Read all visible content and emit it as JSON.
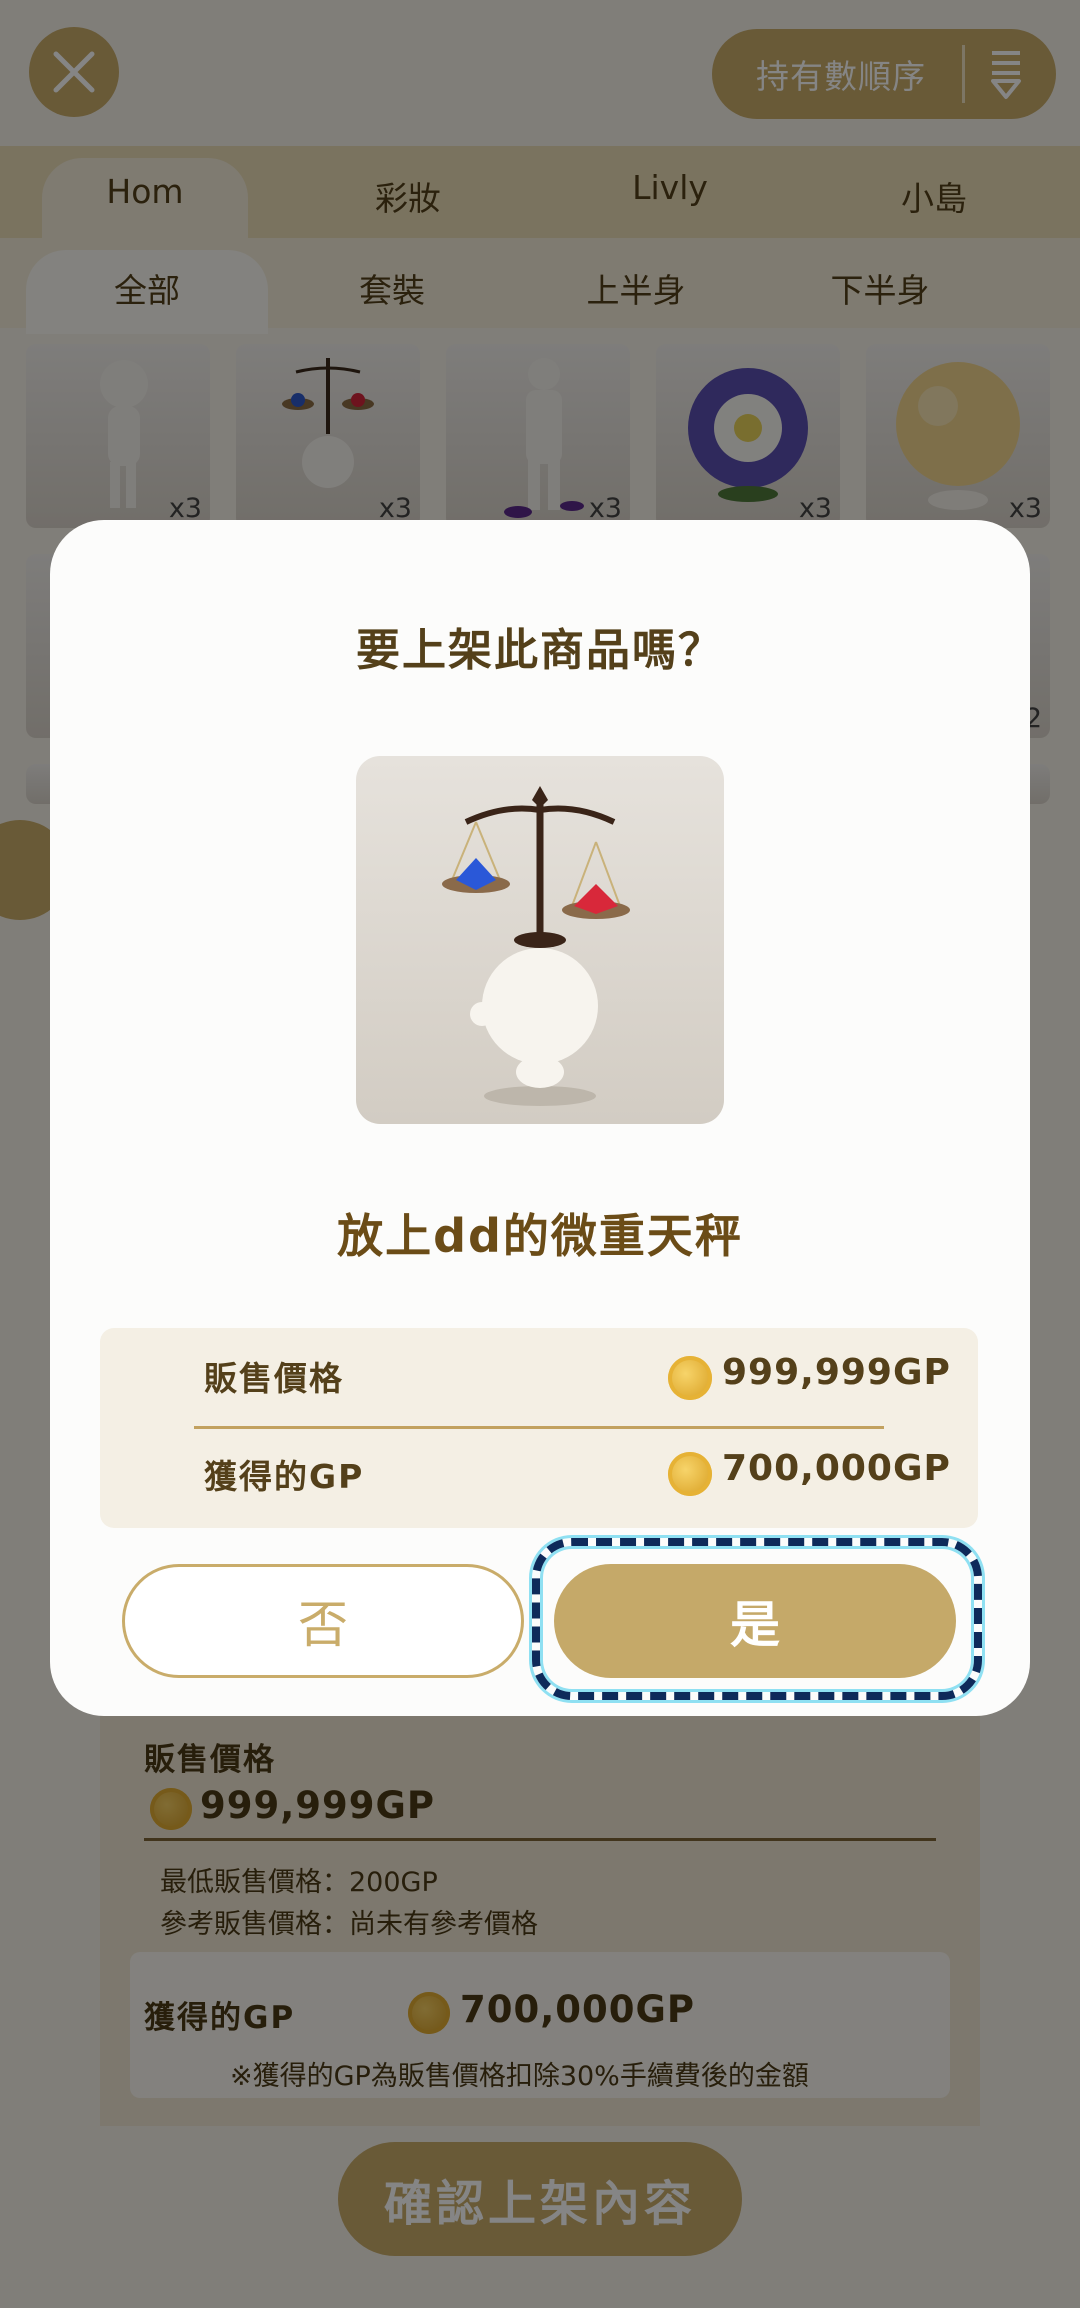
{
  "header": {
    "sort_label": "持有數順序"
  },
  "tabs_primary": [
    "Hom",
    "彩妝",
    "Livly",
    "小島"
  ],
  "tabs_secondary": [
    "全部",
    "套裝",
    "上半身",
    "下半身"
  ],
  "grid": {
    "counts": [
      "x3",
      "x3",
      "x3",
      "x3",
      "x3"
    ],
    "partial_count": "2"
  },
  "sheet": {
    "sale_price_label": "販售價格",
    "sale_price_value": "999,999GP",
    "min_price": "最低販售價格：200GP",
    "ref_price": "參考販售價格：尚未有參考價格",
    "earned_label": "獲得的GP",
    "earned_value": "700,000GP",
    "fee_note": "※獲得的GP為販售價格扣除30%手續費後的金額",
    "confirm_label": "確認上架內容"
  },
  "modal": {
    "title": "要上架此商品嗎？",
    "item_name": "放上dd的微重天秤",
    "price_label": "販售價格",
    "price_value": "999,999GP",
    "earned_label": "獲得的GP",
    "earned_value": "700,000GP",
    "no_label": "否",
    "yes_label": "是"
  },
  "colors": {
    "gold": "#c9ac6a",
    "text_brown": "#54401a",
    "highlight_dash": "#0e2a5a",
    "highlight_glow": "#8fe0f2"
  }
}
